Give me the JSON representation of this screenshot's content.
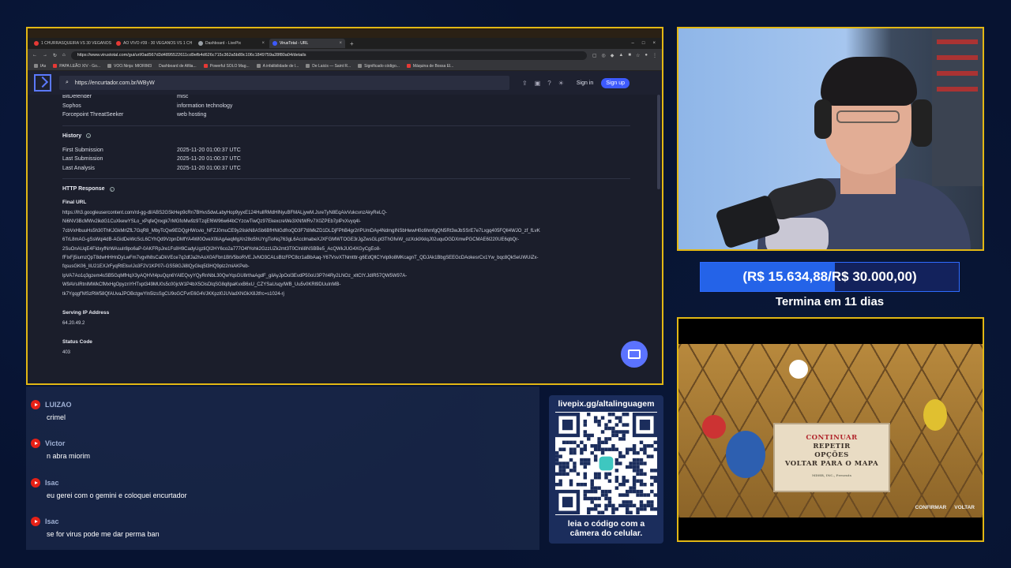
{
  "browser": {
    "tabs": [
      {
        "label": "1 CHURRASQUEIRA VS 30 VEGANOS",
        "color": "#e53935",
        "active": false
      },
      {
        "label": "AO VIVO #39 - 30 VEGANOS VS 1 CH",
        "color": "#e53935",
        "active": false
      },
      {
        "label": "Dashboard - LivePix",
        "color": "#9aa0a6",
        "active": false
      },
      {
        "label": "VirusTotal - URL",
        "color": "#3d5afe",
        "active": true
      }
    ],
    "url": "https://www.virustotal.com/gui/url/0ad567d3d4895522611cd9efb4d626c715c362a5b89c106c1849759a28f80a04/details",
    "bookmarks": [
      "IAs",
      "PAPA LEÃO XIV - Go...",
      "VOO.Ninja: MIORIM3",
      "Dashboard de Afilia...",
      "Powerful SOLO Mag...",
      "A infalibilidade de l...",
      "De Laicis — Saint R...",
      "Significado código...",
      "Máquina de Bossa El..."
    ]
  },
  "virustotal": {
    "search_value": "https://encurtador.com.br/WByW",
    "signin_label": "Sign in",
    "signup_label": "Sign up",
    "categories": [
      {
        "vendor": "BitDefender",
        "category": "misc"
      },
      {
        "vendor": "Sophos",
        "category": "information technology"
      },
      {
        "vendor": "Forcepoint ThreatSeeker",
        "category": "web hosting"
      }
    ],
    "history_title": "History",
    "history": [
      {
        "label": "First Submission",
        "value": "2025-11-20 01:00:37 UTC"
      },
      {
        "label": "Last Submission",
        "value": "2025-11-20 01:00:37 UTC"
      },
      {
        "label": "Last Analysis",
        "value": "2025-11-20 01:00:37 UTC"
      }
    ],
    "http_title": "HTTP Response",
    "final_url_label": "Final URL",
    "final_url_lines": [
      "https://lh3.googleusercontent.com/rd-gg-dl/ABS2GSkHep9cRn7BHvs5dwLabyHop9yyxE124HullRMdHlNyuBFMALjywM.JsreTyN8EqAivVukcvnzAkyReLQ-",
      "Ni6NV3BcMWv2ikdG1CuXkewYSLo_xPqfeQnxgk7rMGfoMw9z9TzqEf6W96w64bCYzcwTiwQz97EkexcreWe3XNtWRv7X0ZPEb7plPxXvyq4l-",
      "7cbVxHbuuHs5h30ThKJGkMrlZfL7GqR8_MbyTcQw9EDQgHWcvio_NFZJ0muCE9y2IiskN8ASb6BfHNlGdfroQD3F7t8MkZD1DLDjFPhB4gr2rlPUmDAy4NdmgINSbHwwH0c6hmfgQN5Rt3wJbSSrE7e7Lxgq405FQlI4WJO_zf_fLvK",
      "6TrL8mAG-gSsWqi4dB-AGidDeWcScL6CYhQd9VzpnDMfYA4Wl0OveX0liAgAeqMgXn28o5hUYgTioNq763gL6AcclmabeXJXFGMWTOGE3rJgZwsGLpt3ThGfviW_ozXcklXklqJ02uquOGDXmwPGCMAE6l220UE6qbQr-",
      "2SuOnAUqE4FIdxyfNrWAsulr8po6aP-0AKFRpJre1Fs8H9CadyUgzliQI2HY6co2a777O4fYohk2GzzUZk2mt3T0Clnli8NSBBe5_AcQWkJUG4XGyCgEo8-",
      "fFIxFj5iumzQpT8dwHHHnDyLwFm7vgvlh8sCaDkVEce7q2dfJa2hAoX0AFbn1BtV5boRVE.JvNO3CALsBtzFPC8cr1aBbAaq-Y67VsvXTNmtttr-g6EdQllCYvlp9o8MKcagnT_QDJAk1BbgSEEGcDAokesrCx1Yw_bqc8QkSeUWUiZx-",
      "fqsusGK06_llU21EXJrFyqRtElsvIJo3F2V1KP07i-GS58GJi8lQyGkq5l3HQ9plz2miAKPeb-",
      "lpVA7Ao1q3gzem4sSB5GqMfHqX3yAQHVt4puQqn6YAlEQvyYQyRnNbL30QwYqsGU8rthaAgdF_gilAyJpOol3EvdP50oU3P7rl4Ry2LNOz_xltCtY.JdIR57QW5W97A-",
      "W9AVsIRtnIMWkCfMxHgOpyznYHTxpt349MU0s5c00jcW1P4bX5OisDlqSG8q8paKvxB6xU_CZYSaUsqyIWB_Uu5v0KRl9DUuInMB-",
      "tk7Ygqgf'MSzRW58QfAUvaJPOBctgwYln5lzsSgCU9oGCFvrE6G4VJKKpzl0JUVadXNGkX8Jtfrc=s1024-rj"
    ],
    "serving_ip_label": "Serving IP Address",
    "serving_ip": "64.20.49.2",
    "status_code_label": "Status Code",
    "status_code": "403"
  },
  "goal": {
    "text": "(R$ 15.634,88/R$ 30.000,00)",
    "current": 15634.88,
    "target": 30000.0,
    "subtitle": "Termina em 11 dias"
  },
  "game": {
    "menu": [
      "CONTINUAR",
      "REPETIR",
      "OPÇÕES",
      "VOLTAR PARA O MAPA"
    ],
    "brand": "MDHR, INC., Presents",
    "hint_confirm": "CONFIRMAR",
    "hint_back": "VOLTAR"
  },
  "chat": [
    {
      "name": "LUIZAO",
      "text": "crimel"
    },
    {
      "name": "Victor",
      "text": "n abra miorim"
    },
    {
      "name": "Isac",
      "text": "eu gerei com o gemini e coloquei encurtador"
    },
    {
      "name": "Isac",
      "text": "se for virus pode me dar perma ban"
    }
  ],
  "qr": {
    "url": "livepix.gg/altalinguagem",
    "caption_line1": "leia o código com a",
    "caption_line2": "câmera do celular."
  }
}
